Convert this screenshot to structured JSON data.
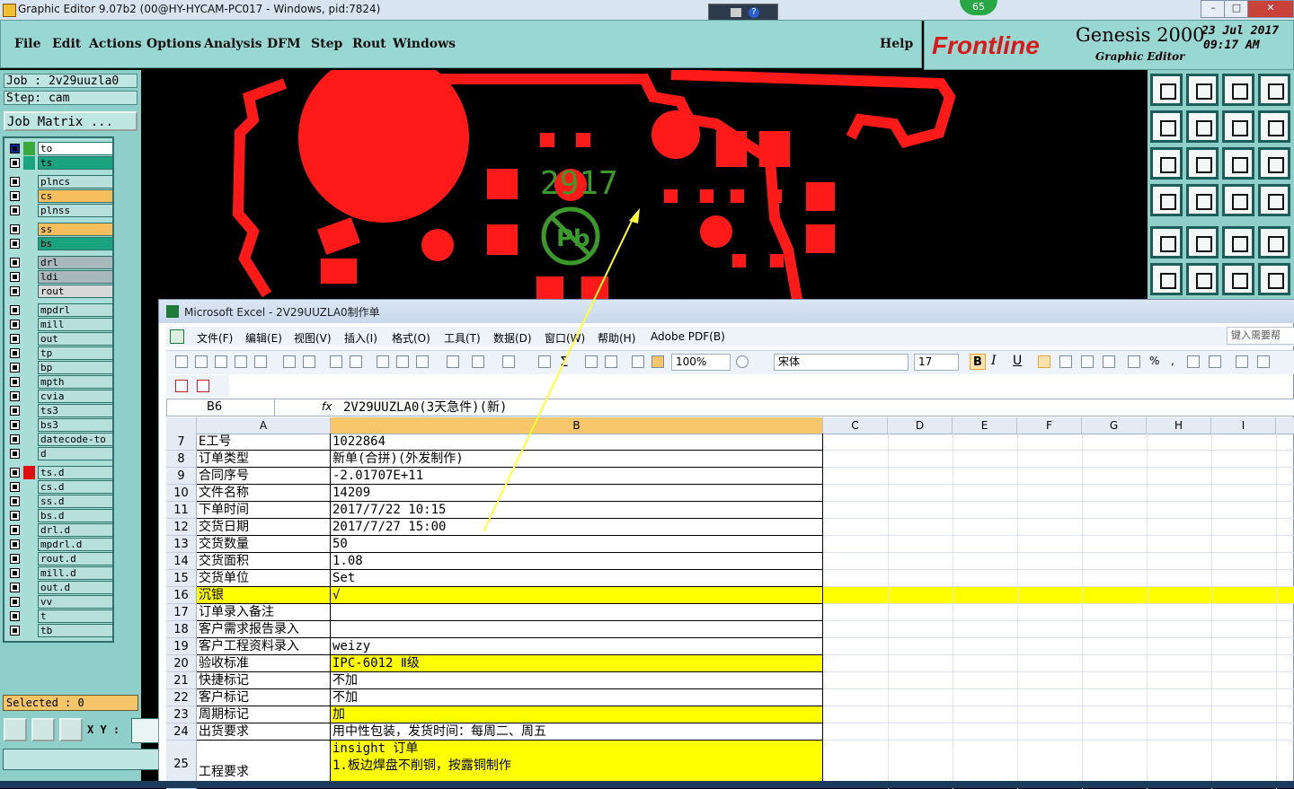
{
  "genesis": {
    "window_title": "Graphic Editor 9.07b2 (00@HY-HYCAM-PC017 - Windows, pid:7824)",
    "badge": "65",
    "menu": [
      "File",
      "Edit",
      "Actions",
      "Options",
      "Analysis",
      "DFM",
      "Step",
      "Rout",
      "Windows"
    ],
    "help": "Help",
    "brand": "Frontline",
    "product": "Genesis 2000",
    "subtitle": "Graphic Editor",
    "date": "23 Jul 2017",
    "time": "09:17 AM",
    "job": "Job : 2v29uuzla0",
    "step": "Step: cam",
    "job_matrix": "Job Matrix ...",
    "layers": [
      {
        "name": "to",
        "color": "#ffffff",
        "sw": "#3aa83a",
        "active": true
      },
      {
        "name": "ts",
        "color": "#1aa37f",
        "sw": "#1aa37f"
      },
      {
        "name": "plncs",
        "color": "#b7e0dc",
        "sw": ""
      },
      {
        "name": "cs",
        "color": "#f6be5c",
        "sw": ""
      },
      {
        "name": "plnss",
        "color": "#b7e0dc",
        "sw": ""
      },
      {
        "name": "ss",
        "color": "#f6be5c",
        "sw": ""
      },
      {
        "name": "bs",
        "color": "#1aa37f",
        "sw": ""
      },
      {
        "name": "drl",
        "color": "#a9b8bd",
        "sw": ""
      },
      {
        "name": "ldi",
        "color": "#a9b8bd",
        "sw": ""
      },
      {
        "name": "rout",
        "color": "#d8d8d8",
        "sw": ""
      },
      {
        "name": "mpdrl",
        "color": "#b7e0dc",
        "sw": ""
      },
      {
        "name": "mill",
        "color": "#b7e0dc",
        "sw": ""
      },
      {
        "name": "out",
        "color": "#b7e0dc",
        "sw": ""
      },
      {
        "name": "tp",
        "color": "#b7e0dc",
        "sw": ""
      },
      {
        "name": "bp",
        "color": "#b7e0dc",
        "sw": ""
      },
      {
        "name": "mpth",
        "color": "#b7e0dc",
        "sw": ""
      },
      {
        "name": "cvia",
        "color": "#b7e0dc",
        "sw": ""
      },
      {
        "name": "ts3",
        "color": "#b7e0dc",
        "sw": ""
      },
      {
        "name": "bs3",
        "color": "#b7e0dc",
        "sw": ""
      },
      {
        "name": "datecode-to",
        "color": "#b7e0dc",
        "sw": ""
      },
      {
        "name": "d",
        "color": "#b7e0dc",
        "sw": ""
      },
      {
        "name": "ts.d",
        "color": "#b7e0dc",
        "sw": "#e01010"
      },
      {
        "name": "cs.d",
        "color": "#b7e0dc",
        "sw": ""
      },
      {
        "name": "ss.d",
        "color": "#b7e0dc",
        "sw": ""
      },
      {
        "name": "bs.d",
        "color": "#b7e0dc",
        "sw": ""
      },
      {
        "name": "drl.d",
        "color": "#b7e0dc",
        "sw": ""
      },
      {
        "name": "mpdrl.d",
        "color": "#b7e0dc",
        "sw": ""
      },
      {
        "name": "rout.d",
        "color": "#b7e0dc",
        "sw": ""
      },
      {
        "name": "mill.d",
        "color": "#b7e0dc",
        "sw": ""
      },
      {
        "name": "out.d",
        "color": "#b7e0dc",
        "sw": ""
      },
      {
        "name": "vv",
        "color": "#b7e0dc",
        "sw": ""
      },
      {
        "name": "t",
        "color": "#b7e0dc",
        "sw": ""
      },
      {
        "name": "tb",
        "color": "#b7e0dc",
        "sw": ""
      }
    ],
    "selected": "Selected : 0",
    "xy_label": "X Y :",
    "board_text": "2917",
    "pb_mark": "Pb"
  },
  "excel": {
    "title": "Microsoft Excel - 2V29UUZLA0制作单",
    "menu": [
      "文件(F)",
      "编辑(E)",
      "视图(V)",
      "插入(I)",
      "格式(O)",
      "工具(T)",
      "数据(D)",
      "窗口(W)",
      "帮助(H)",
      "Adobe PDF(B)"
    ],
    "help_placeholder": "键入需要帮",
    "zoom": "100%",
    "font": "宋体",
    "font_size": "17",
    "name_box": "B6",
    "fx": "fx",
    "formula": "2V29UUZLA0(3天急件)(新)",
    "columns": [
      "A",
      "B",
      "C",
      "D",
      "E",
      "F",
      "G",
      "H",
      "I"
    ],
    "rows": [
      {
        "n": "7",
        "a": "E工号",
        "b": "1022864",
        "hl": false
      },
      {
        "n": "8",
        "a": "订单类型",
        "b": "新单(合拼)(外发制作)",
        "hl": false
      },
      {
        "n": "9",
        "a": "合同序号",
        "b": "-2.01707E+11",
        "hl": false
      },
      {
        "n": "10",
        "a": "文件名称",
        "b": "14209",
        "hl": false
      },
      {
        "n": "11",
        "a": "下单时间",
        "b": "2017/7/22 10:15",
        "hl": false
      },
      {
        "n": "12",
        "a": "交货日期",
        "b": "2017/7/27 15:00",
        "hl": false
      },
      {
        "n": "13",
        "a": "交货数量",
        "b": "50",
        "hl": false
      },
      {
        "n": "14",
        "a": "交货面积",
        "b": "1.08",
        "hl": false
      },
      {
        "n": "15",
        "a": "交货单位",
        "b": "Set",
        "hl": false
      },
      {
        "n": "16",
        "a": "沉银",
        "b": "√",
        "hl": true,
        "full": true
      },
      {
        "n": "17",
        "a": "订单录入备注",
        "b": "",
        "hl": false
      },
      {
        "n": "18",
        "a": "客户需求报告录入",
        "b": "",
        "hl": false
      },
      {
        "n": "19",
        "a": "客户工程资料录入",
        "b": "weizy",
        "hl": false
      },
      {
        "n": "20",
        "a": "验收标准",
        "b": "IPC-6012 Ⅱ级",
        "hl": true
      },
      {
        "n": "21",
        "a": "快捷标记",
        "b": "不加",
        "hl": false
      },
      {
        "n": "22",
        "a": "客户标记",
        "b": "不加",
        "hl": false
      },
      {
        "n": "23",
        "a": "周期标记",
        "b": "加",
        "hl": true
      },
      {
        "n": "24",
        "a": "出货要求",
        "b": "用中性包装，发货时间：每周二、周五",
        "hl": false
      }
    ],
    "row25": {
      "a": "工程要求",
      "b1": "insight 订单",
      "b2": "1.板边焊盘不削铜，按露铜制作"
    },
    "highlight": "#ffff00"
  }
}
